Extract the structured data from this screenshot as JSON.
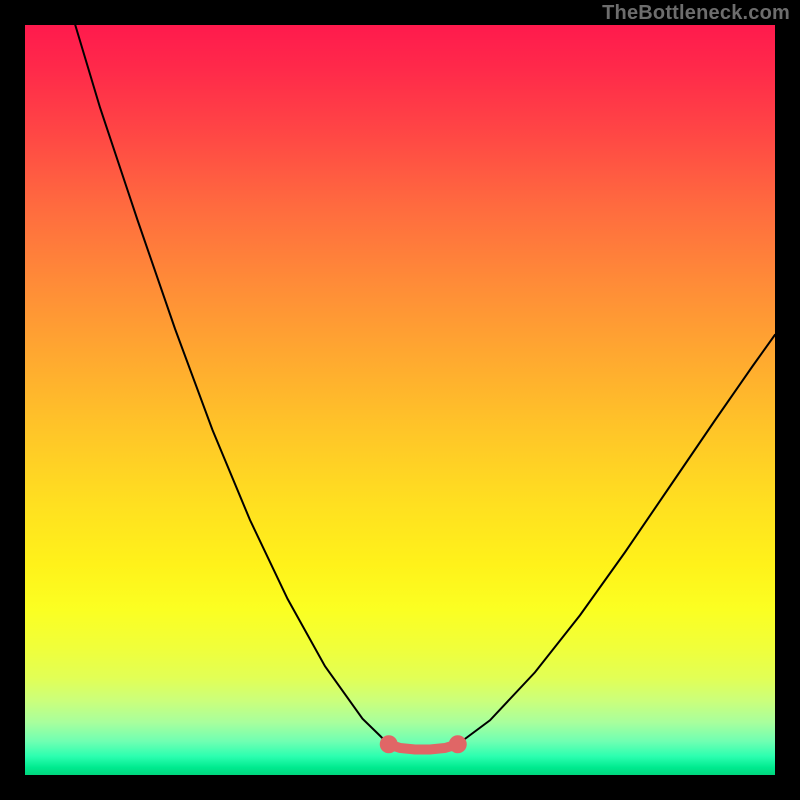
{
  "watermark": "TheBottleneck.com",
  "colors": {
    "frame": "#000000",
    "curve_stroke": "#000000",
    "flat_segment": "#e06666",
    "gradient_top": "#ff1a4d",
    "gradient_bottom": "#00d67d"
  },
  "chart_data": {
    "type": "line",
    "title": "",
    "xlabel": "",
    "ylabel": "",
    "xlim": [
      0,
      100
    ],
    "ylim": [
      0,
      100
    ],
    "series": [
      {
        "name": "left-curve",
        "x": [
          6.7,
          10,
          15,
          20,
          25,
          30,
          35,
          40,
          45,
          48.5
        ],
        "y": [
          100,
          89,
          74,
          59.5,
          46,
          34,
          23.5,
          14.5,
          7.5,
          4.1
        ]
      },
      {
        "name": "flat-bottom",
        "x": [
          48.5,
          50,
          52,
          54,
          56,
          57.7
        ],
        "y": [
          4.1,
          3.6,
          3.4,
          3.4,
          3.6,
          4.1
        ]
      },
      {
        "name": "right-curve",
        "x": [
          57.7,
          62,
          68,
          74,
          80,
          86,
          92,
          97,
          100
        ],
        "y": [
          4.1,
          7.3,
          13.7,
          21.3,
          29.7,
          38.5,
          47.3,
          54.5,
          58.7
        ]
      }
    ],
    "flat_segment_endpoints": {
      "left": {
        "x": 48.5,
        "y": 4.1
      },
      "right": {
        "x": 57.7,
        "y": 4.1
      }
    }
  }
}
